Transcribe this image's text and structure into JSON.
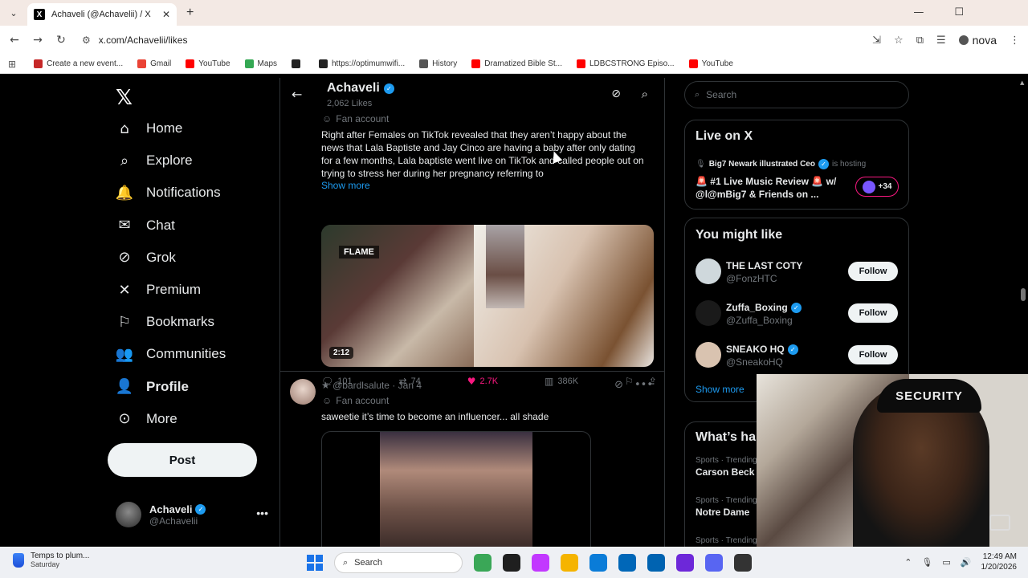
{
  "browser": {
    "tab_title": "Achaveli (@Achavelii) / X",
    "tab_favicon": "X",
    "url": "x.com/Achavelii/likes",
    "profile_name": "nova",
    "bookmarks": [
      {
        "label": "Create a new event...",
        "color": "#c62828"
      },
      {
        "label": "Gmail",
        "color": "#ea4335"
      },
      {
        "label": "YouTube",
        "color": "#ff0000"
      },
      {
        "label": "Maps",
        "color": "#34a853"
      },
      {
        "label": "",
        "color": "#222222"
      },
      {
        "label": "https://optimumwifi...",
        "color": "#222222"
      },
      {
        "label": "History",
        "color": "#555555"
      },
      {
        "label": "Dramatized Bible St...",
        "color": "#ff0000"
      },
      {
        "label": "LDBCSTRONG Episo...",
        "color": "#ff0000"
      },
      {
        "label": "YouTube",
        "color": "#ff0000"
      }
    ]
  },
  "nav": {
    "items": [
      {
        "label": "Home",
        "icon": "home-icon"
      },
      {
        "label": "Explore",
        "icon": "search-icon"
      },
      {
        "label": "Notifications",
        "icon": "bell-icon"
      },
      {
        "label": "Chat",
        "icon": "mail-icon"
      },
      {
        "label": "Grok",
        "icon": "grok-icon"
      },
      {
        "label": "Premium",
        "icon": "x-icon"
      },
      {
        "label": "Bookmarks",
        "icon": "bookmark-icon"
      },
      {
        "label": "Communities",
        "icon": "people-icon"
      },
      {
        "label": "Profile",
        "icon": "person-icon"
      },
      {
        "label": "More",
        "icon": "more-icon"
      }
    ],
    "post_label": "Post",
    "me_name": "Achaveli",
    "me_handle": "@Achavelii"
  },
  "header": {
    "title": "Achaveli",
    "subtitle": "2,062 Likes"
  },
  "post1": {
    "label": "Fan account",
    "text": "Right after Females on TikTok revealed that they aren’t happy about the news that Lala Baptiste and Jay Cinco are having a baby after only dating for a few months, Lala baptiste went live on TikTok and called people out on trying to stress her during her pregnancy referring to",
    "show_more": "Show more",
    "media_tag": "FLAME",
    "duration": "2:12",
    "replies": "101",
    "reposts": "74",
    "likes": "2.7K",
    "views": "386K"
  },
  "post2": {
    "author": "★ @bardlsalute · Jan 4",
    "label": "Fan account",
    "text": "saweetie it’s time to become an influencer... all shade"
  },
  "sidebar": {
    "search_placeholder": "Search",
    "live_title": "Live on X",
    "live_host_name": "Big7 Newark illustrated Ceo",
    "live_host_suffix": "is hosting",
    "live_space": "🚨 #1 Live Music Review 🚨 w/ @l@mBig7 & Friends on ...",
    "live_count": "+34",
    "might_like_title": "You might like",
    "suggestions": [
      {
        "name": "THE LAST COTY",
        "handle": "@FonzHTC",
        "verified": false,
        "follow": "Follow",
        "color": "#cfd8dc"
      },
      {
        "name": "Zuffa_Boxing",
        "handle": "@Zuffa_Boxing",
        "verified": true,
        "follow": "Follow",
        "color": "#1a1a1a"
      },
      {
        "name": "SNEAKO HQ",
        "handle": "@SneakoHQ",
        "verified": true,
        "follow": "Follow",
        "color": "#d9c3b0"
      }
    ],
    "show_more": "Show more",
    "happening_title": "What’s happening",
    "trends": [
      {
        "category": "Sports · Trending",
        "name": "Carson Beck"
      },
      {
        "category": "Sports · Trending",
        "name": "Notre Dame"
      },
      {
        "category": "Sports · Trending",
        "name": ""
      }
    ]
  },
  "webcam": {
    "cap_text": "SECURITY"
  },
  "taskbar": {
    "weather_title": "Temps to plum...",
    "weather_sub": "Saturday",
    "search_label": "Search",
    "time": "12:49 AM",
    "date": "1/20/2026",
    "apps": [
      "#3aa757",
      "#1f1f1f",
      "#c238ff",
      "#f5b400",
      "#0a7cd8",
      "#0067b8",
      "#0063b1",
      "#6d28d9",
      "#5865f2",
      "#333333"
    ]
  }
}
